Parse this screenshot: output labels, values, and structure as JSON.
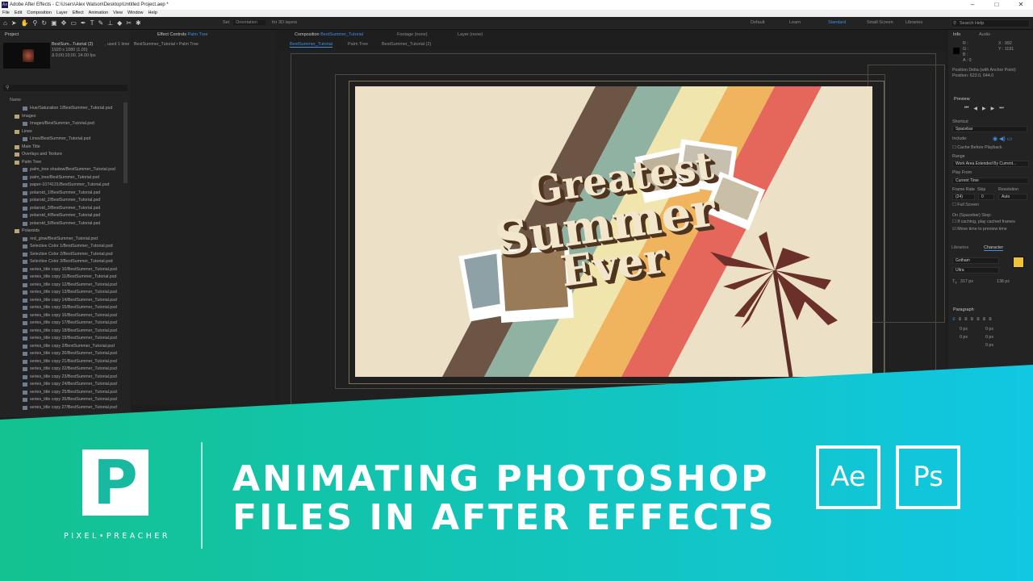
{
  "window": {
    "title": "Adobe After Effects - C:\\Users\\Alex Watson\\Desktop\\Untitled Project.aep *",
    "app_icon": "Ae"
  },
  "menu": [
    "File",
    "Edit",
    "Composition",
    "Layer",
    "Effect",
    "Animation",
    "View",
    "Window",
    "Help"
  ],
  "toolbar": {
    "set_label": "Set",
    "orientation": "Orientation",
    "for_3d": "for 3D layers",
    "workspaces": [
      "Default",
      "Learn",
      "Standard",
      "Small Screen",
      "Libraries"
    ],
    "active_workspace": "Standard",
    "search_help": "Search Help"
  },
  "project": {
    "tab": "Project",
    "comp_name": "BestSum...Tutorial (2)",
    "used": ", used 1 time",
    "dims": "1920 x 1080 (1.00)",
    "duration": "Δ 0;00;10;00, 24.00 fps",
    "name_col": "Name",
    "items": [
      {
        "label": "Hue/Saturation 1/BestSummer_Tutorial.psd",
        "folder": false
      },
      {
        "label": "Images",
        "folder": true
      },
      {
        "label": "Images/BestSummer_Tutorial.psd",
        "folder": false
      },
      {
        "label": "Lines",
        "folder": true
      },
      {
        "label": "Lines/BestSummer_Tutorial.psd",
        "folder": false
      },
      {
        "label": "Main Title",
        "folder": true
      },
      {
        "label": "Overlays and Texture",
        "folder": true
      },
      {
        "label": "Palm Tree",
        "folder": true
      },
      {
        "label": "palm_tree shadow/BestSummer_Tutorial.psd",
        "folder": false
      },
      {
        "label": "palm_tree/BestSummer_Tutorial.psd",
        "folder": false
      },
      {
        "label": "paper-1074131/BestSummer_Tutorial.psd",
        "folder": false
      },
      {
        "label": "polaroid_1/BestSummer_Tutorial.psd",
        "folder": false
      },
      {
        "label": "polaroid_2/BestSummer_Tutorial.psd",
        "folder": false
      },
      {
        "label": "polaroid_3/BestSummer_Tutorial.psd",
        "folder": false
      },
      {
        "label": "polaroid_4/BestSummer_Tutorial.psd",
        "folder": false
      },
      {
        "label": "polaroid_5/BestSummer_Tutorial.psd",
        "folder": false
      },
      {
        "label": "Polaroids",
        "folder": true
      },
      {
        "label": "red_glow/BestSummer_Tutorial.psd",
        "folder": false
      },
      {
        "label": "Selective Color 1/BestSummer_Tutorial.psd",
        "folder": false
      },
      {
        "label": "Selective Color 2/BestSummer_Tutorial.psd",
        "folder": false
      },
      {
        "label": "Selective Color 3/BestSummer_Tutorial.psd",
        "folder": false
      },
      {
        "label": "series_title copy 10/BestSummer_Tutorial.psd",
        "folder": false
      },
      {
        "label": "series_title copy 11/BestSummer_Tutorial.psd",
        "folder": false
      },
      {
        "label": "series_title copy 12/BestSummer_Tutorial.psd",
        "folder": false
      },
      {
        "label": "series_title copy 13/BestSummer_Tutorial.psd",
        "folder": false
      },
      {
        "label": "series_title copy 14/BestSummer_Tutorial.psd",
        "folder": false
      },
      {
        "label": "series_title copy 15/BestSummer_Tutorial.psd",
        "folder": false
      },
      {
        "label": "series_title copy 16/BestSummer_Tutorial.psd",
        "folder": false
      },
      {
        "label": "series_title copy 17/BestSummer_Tutorial.psd",
        "folder": false
      },
      {
        "label": "series_title copy 18/BestSummer_Tutorial.psd",
        "folder": false
      },
      {
        "label": "series_title copy 19/BestSummer_Tutorial.psd",
        "folder": false
      },
      {
        "label": "series_title copy 2/BestSummer_Tutorial.psd",
        "folder": false
      },
      {
        "label": "series_title copy 20/BestSummer_Tutorial.psd",
        "folder": false
      },
      {
        "label": "series_title copy 21/BestSummer_Tutorial.psd",
        "folder": false
      },
      {
        "label": "series_title copy 22/BestSummer_Tutorial.psd",
        "folder": false
      },
      {
        "label": "series_title copy 23/BestSummer_Tutorial.psd",
        "folder": false
      },
      {
        "label": "series_title copy 24/BestSummer_Tutorial.psd",
        "folder": false
      },
      {
        "label": "series_title copy 25/BestSummer_Tutorial.psd",
        "folder": false
      },
      {
        "label": "series_title copy 26/BestSummer_Tutorial.psd",
        "folder": false
      },
      {
        "label": "series_title copy 27/BestSummer_Tutorial.psd",
        "folder": false
      }
    ]
  },
  "effect_controls": {
    "tab": "Effect Controls",
    "layer": "Palm Tree",
    "breadcrumb": "BestSummer_Tutorial • Palm Tree"
  },
  "composition": {
    "tab": "Composition",
    "comp": "BestSummer_Tutorial",
    "footage": "Footage (none)",
    "layer": "Layer (none)",
    "subtabs": [
      "BestSummer_Tutorial",
      "Palm Tree",
      "BestSummer_Tutorial (2)"
    ],
    "art_title": [
      "Greatest",
      "Summer",
      "Ever"
    ]
  },
  "info": {
    "tabs": [
      "Info",
      "Audio"
    ],
    "r": "R :",
    "g": "G :",
    "b": "B :",
    "a": "A : 0",
    "x": "X : 992",
    "y": "Y : 1191",
    "delta": "Position Delta (with Anchor Point)",
    "position": "Position: 623.0, 644.0"
  },
  "preview": {
    "tab": "Preview",
    "shortcut_label": "Shortcut",
    "shortcut": "Spacebar",
    "include": "Include:",
    "cache": "Cache Before Playback",
    "range_label": "Range",
    "range": "Work Area Extended By Current...",
    "play_from_label": "Play From",
    "play_from": "Current Time",
    "frame_rate_label": "Frame Rate",
    "skip_label": "Skip",
    "resolution_label": "Resolution",
    "frame_rate": "(24)",
    "skip": "0",
    "resolution": "Auto",
    "full_screen": "Full Screen",
    "on_stop": "On (Spacebar) Stop:",
    "if_caching": "If caching, play cached frames",
    "move_time": "Move time to preview time"
  },
  "character": {
    "tabs": [
      "Libraries",
      "Character"
    ],
    "font": "Gotham",
    "style": "Ultra",
    "size": "317 px",
    "leading": "138 px",
    "color": "#f0c23a"
  },
  "paragraph": {
    "tab": "Paragraph",
    "values": [
      "0 px",
      "0 px",
      "0 px",
      "0 px",
      "0 px"
    ]
  },
  "banner": {
    "line1": "ANIMATING PHOTOSHOP",
    "line2": "FILES IN AFTER EFFECTS",
    "logo_letter": "P",
    "logo_name": "PIXEL•PREACHER",
    "apps": [
      "Ae",
      "Ps"
    ],
    "gradient_start": "#13c28f",
    "gradient_end": "#11c7e2"
  }
}
